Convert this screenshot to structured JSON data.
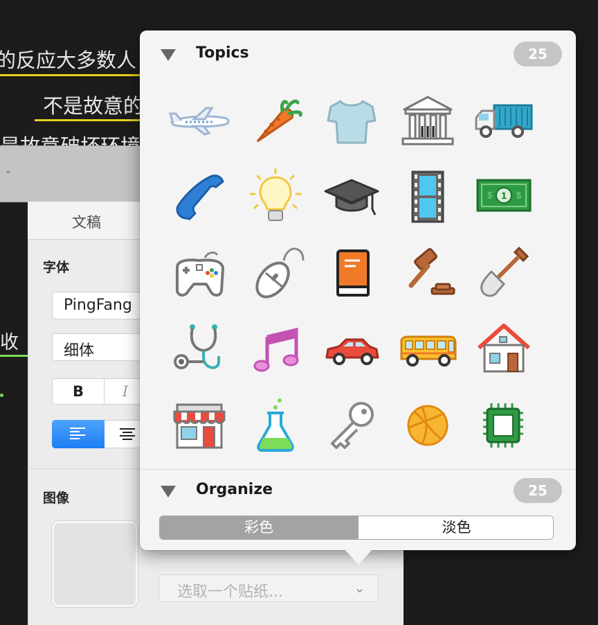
{
  "background": {
    "lines": [
      "的反应大多数人",
      "不是故意的",
      "是故意破坏环境",
      "收"
    ]
  },
  "inspector": {
    "tab_label": "文稿",
    "font_heading": "字体",
    "font_name": "PingFang",
    "font_style": "细体",
    "bold_label": "B",
    "italic_label": "I",
    "image_heading": "图像",
    "sticker_placeholder": "选取一个贴纸...",
    "sticker_chevron": "⌄"
  },
  "popover": {
    "topics": {
      "title": "Topics",
      "count": "25"
    },
    "organize": {
      "title": "Organize",
      "count": "25"
    },
    "segments": {
      "color": "彩色",
      "light": "淡色",
      "selected": "彩色"
    },
    "icons": [
      "airplane-icon",
      "carrot-icon",
      "tshirt-icon",
      "bank-icon",
      "truck-icon",
      "phone-icon",
      "lightbulb-icon",
      "graduation-cap-icon",
      "film-strip-icon",
      "money-icon",
      "gamepad-icon",
      "mouse-icon",
      "book-icon",
      "gavel-icon",
      "shovel-icon",
      "stethoscope-icon",
      "music-note-icon",
      "car-icon",
      "bus-icon",
      "house-icon",
      "store-icon",
      "flask-icon",
      "key-icon",
      "basketball-icon",
      "chip-icon"
    ],
    "money_label": "1",
    "accent_colors": {
      "blue": "#2f7fd6",
      "orange": "#f07a28",
      "segment_selected": "#a3a3a3",
      "badge": "#c5c5c5"
    }
  }
}
